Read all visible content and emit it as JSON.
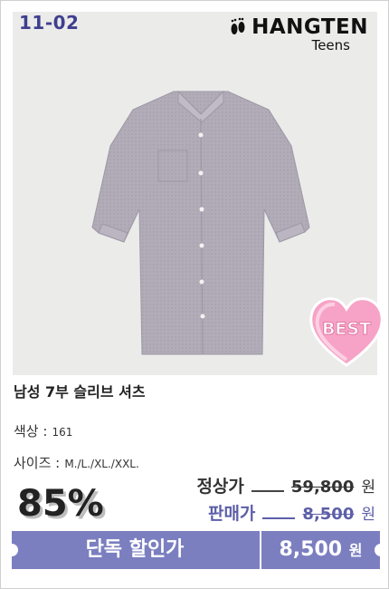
{
  "product": {
    "code": "11-02",
    "brand": "HANGTEN",
    "brand_sub": "Teens",
    "badge": "BEST",
    "title": "남성 7부 슬리브 셔츠",
    "color_label": "색상 :",
    "color_value": "161",
    "size_label": "사이즈 :",
    "size_value": "M./L./XL./XXL.",
    "discount_pct": "85%",
    "regular_label": "정상가",
    "regular_price": "59,800",
    "sale_label": "판매가",
    "sale_price": "8,500",
    "currency": "원"
  },
  "cta": {
    "label": "단독 할인가",
    "price": "8,500",
    "currency": "원"
  },
  "colors": {
    "accent": "#7b7fc0",
    "code": "#3f3f8f",
    "sale": "#5d5fa8",
    "badge": "#f7a3c7"
  },
  "icons": [
    "footprints-icon",
    "shirt-image",
    "heart-badge-icon"
  ]
}
